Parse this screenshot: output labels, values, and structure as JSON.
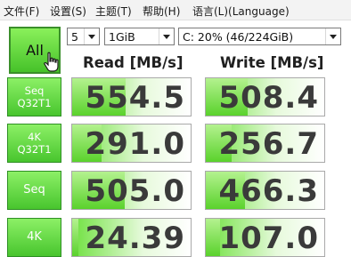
{
  "menu": [
    "文件(F)",
    "设置(S)",
    "主题(T)",
    "帮助(H)",
    "语言(L)(Language)"
  ],
  "controls": {
    "count": "5",
    "size": "1GiB",
    "drive": "C: 20% (46/224GiB)"
  },
  "all_button": "All",
  "headers": {
    "read": "Read [MB/s]",
    "write": "Write [MB/s]"
  },
  "tests": [
    {
      "label_line1": "Seq",
      "label_line2": "Q32T1",
      "read": "554.5",
      "write": "508.4",
      "read_fill": 0.45,
      "write_fill": 0.35
    },
    {
      "label_line1": "4K",
      "label_line2": "Q32T1",
      "read": "291.0",
      "write": "256.7",
      "read_fill": 0.25,
      "write_fill": 0.22
    },
    {
      "label_line1": "Seq",
      "label_line2": "",
      "read": "505.0",
      "write": "466.3",
      "read_fill": 0.44,
      "write_fill": 0.33
    },
    {
      "label_line1": "4K",
      "label_line2": "",
      "read": "24.39",
      "write": "107.0",
      "read_fill": 0.05,
      "write_fill": 0.12
    }
  ],
  "colors": {
    "accent_green": "#46c22a",
    "text_dark": "#3a3a3a"
  }
}
